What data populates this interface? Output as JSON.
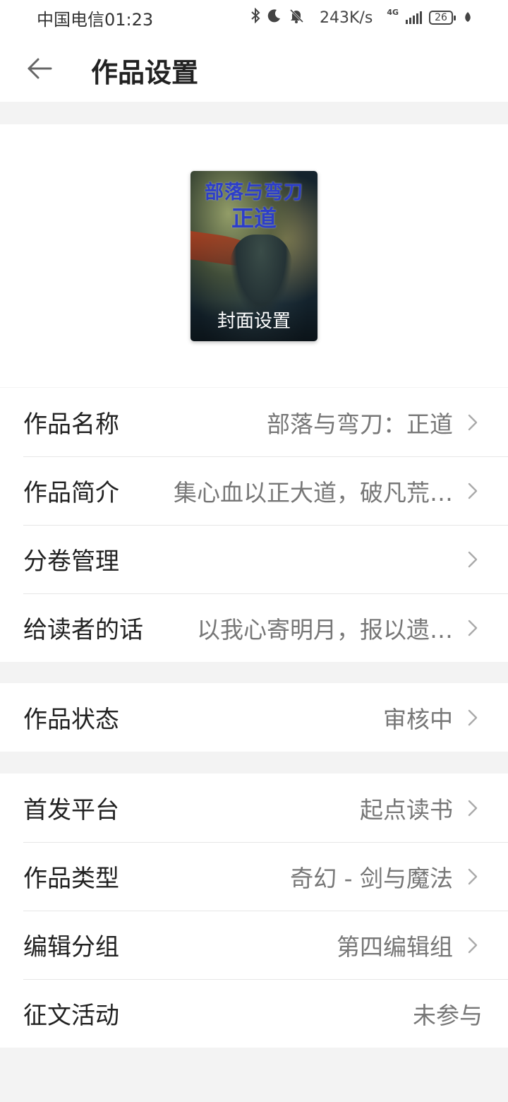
{
  "status": {
    "carrier_time": "中国电信01:23",
    "speed": "243K/s",
    "network": "4G",
    "battery": "26"
  },
  "header": {
    "title": "作品设置"
  },
  "cover": {
    "title_line1": "部落与弯刀",
    "title_line2": "正道",
    "label": "封面设置"
  },
  "group1": [
    {
      "key": "作品名称",
      "value": "部落与弯刀：正道"
    },
    {
      "key": "作品简介",
      "value": "集心血以正大道，破凡荒…"
    },
    {
      "key": "分卷管理",
      "value": ""
    },
    {
      "key": "给读者的话",
      "value": "以我心寄明月，报以遗…"
    }
  ],
  "group2": [
    {
      "key": "作品状态",
      "value": "审核中"
    }
  ],
  "group3": [
    {
      "key": "首发平台",
      "value": "起点读书"
    },
    {
      "key": "作品类型",
      "value": "奇幻 - 剑与魔法"
    },
    {
      "key": "编辑分组",
      "value": "第四编辑组"
    },
    {
      "key": "征文活动",
      "value": "未参与"
    }
  ]
}
